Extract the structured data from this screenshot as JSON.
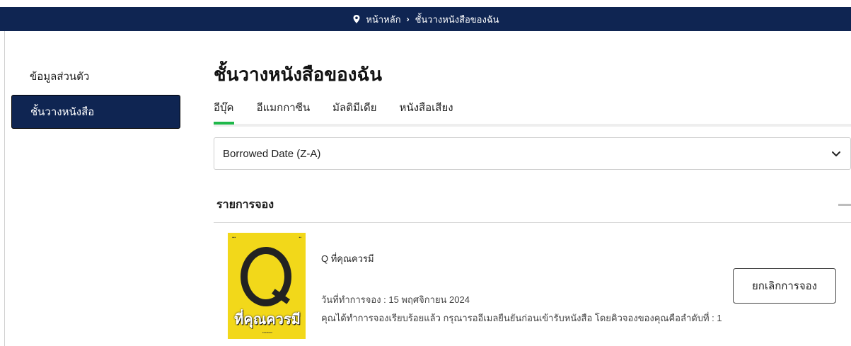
{
  "breadcrumb": {
    "icon": "location-pin-icon",
    "home": "หน้าหลัก",
    "separator": "›",
    "current": "ชั้นวางหนังสือของฉัน"
  },
  "sidebar": {
    "items": [
      {
        "label": "ข้อมูลส่วนตัว",
        "active": false
      },
      {
        "label": "ชั้นวางหนังสือ",
        "active": true
      }
    ]
  },
  "main": {
    "title": "ชั้นวางหนังสือของฉัน",
    "tabs": [
      {
        "label": "อีบุ๊ค",
        "active": true
      },
      {
        "label": "อีแมกกาซีน",
        "active": false
      },
      {
        "label": "มัลติมีเดีย",
        "active": false
      },
      {
        "label": "หนังสือเสียง",
        "active": false
      }
    ],
    "sort": {
      "selected": "Borrowed Date (Z-A)",
      "icon": "chevron-down-icon"
    },
    "section": {
      "title": "รายการจอง"
    },
    "reservation": {
      "cover_title": "ที่คุณควรมี",
      "book_title": "Q ที่คุณควรมี",
      "date_text": "วันที่ทำการจอง : 15 พฤศจิกายน 2024",
      "note_text": "คุณได้ทำการจองเรียบร้อยแล้ว กรุณารออีเมลยืนยันก่อนเข้ารับหนังสือ โดยคิวจองของคุณคือลำดับที่ : 1",
      "cancel_label": "ยกเลิกการจอง"
    }
  },
  "colors": {
    "navy": "#0f2552",
    "accent_green": "#1fb84a",
    "cover_yellow": "#f2d81a"
  }
}
